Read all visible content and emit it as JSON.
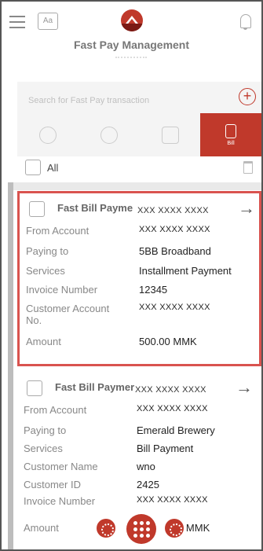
{
  "header": {
    "title": "Fast Pay Management",
    "lang_icon": "language-icon"
  },
  "search": {
    "placeholder": "Search for Fast Pay transaction"
  },
  "tabs": [
    {
      "icon": "people-icon",
      "label": ""
    },
    {
      "icon": "person-icon",
      "label": ""
    },
    {
      "icon": "transfer-icon",
      "label": ""
    },
    {
      "icon": "bill-icon",
      "label": "Bill",
      "active": true
    }
  ],
  "select_all": {
    "label": "All"
  },
  "cards": [
    {
      "title": "Fast Bill Payme",
      "masked_header": "XXX XXXX XXXX",
      "selected": true,
      "rows": [
        {
          "key": "From Account",
          "value": "XXX XXXX XXXX"
        },
        {
          "key": "Paying to",
          "value": "5BB Broadband"
        },
        {
          "key": "Services",
          "value": "Installment Payment"
        },
        {
          "key": "Invoice Number",
          "value": "12345"
        },
        {
          "key": "Customer Account No.",
          "value": "XXX XXXX XXXX"
        },
        {
          "key": "Amount",
          "value": "500.00 MMK"
        }
      ]
    },
    {
      "title": "Fast Bill Paymer",
      "masked_header": "XXX XXXX XXXX",
      "selected": false,
      "rows": [
        {
          "key": "From Account",
          "value": "XXX XXXX XXXX"
        },
        {
          "key": "Paying to",
          "value": "Emerald Brewery"
        },
        {
          "key": "Services",
          "value": "Bill Payment"
        },
        {
          "key": "Customer Name",
          "value": "wno"
        },
        {
          "key": "Customer ID",
          "value": "2425"
        },
        {
          "key": "Invoice Number",
          "value": "XXX XXXX XXXX"
        },
        {
          "key": "Amount",
          "value": "0.00 MMK"
        }
      ]
    }
  ],
  "colors": {
    "accent": "#c0392b",
    "selection_border": "#d9534f"
  }
}
